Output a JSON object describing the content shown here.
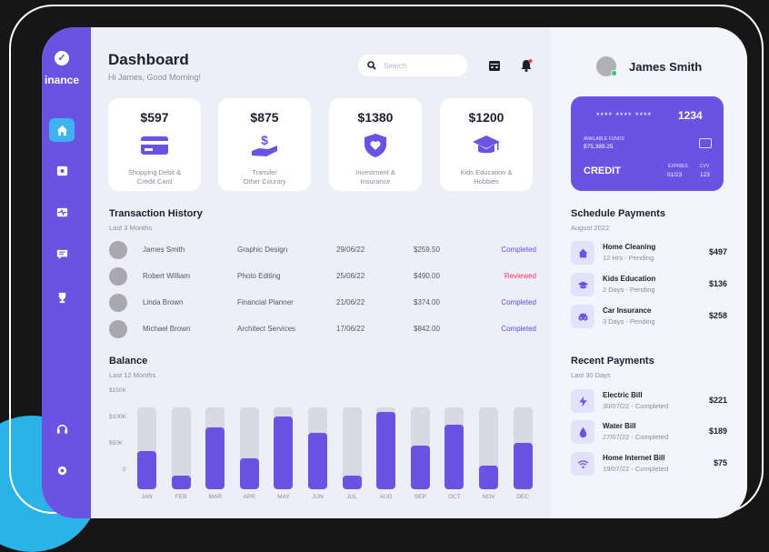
{
  "brand": {
    "logo_text": "inance"
  },
  "header": {
    "title": "Dashboard",
    "greeting": "Hi James, Good Morning!",
    "search_placeholder": "Search"
  },
  "user": {
    "name": "James Smith"
  },
  "stat_cards": [
    {
      "amount": "$597",
      "label_line1": "Shopping Debit &",
      "label_line2": "Credit Card",
      "icon": "credit-card-icon"
    },
    {
      "amount": "$875",
      "label_line1": "Transfer",
      "label_line2": "Other Country",
      "icon": "money-hand-icon"
    },
    {
      "amount": "$1380",
      "label_line1": "Investment &",
      "label_line2": "Insurance",
      "icon": "shield-heart-icon"
    },
    {
      "amount": "$1200",
      "label_line1": "Kids Education &",
      "label_line2": "Hobbies",
      "icon": "graduation-cap-icon"
    }
  ],
  "transactions": {
    "title": "Transaction History",
    "subtitle": "Last 3 Months",
    "rows": [
      {
        "name": "James Smith",
        "category": "Graphic Design",
        "date": "29/06/22",
        "amount": "$259.50",
        "status": "Completed"
      },
      {
        "name": "Robert William",
        "category": "Photo Editing",
        "date": "25/06/22",
        "amount": "$490.00",
        "status": "Reviewed"
      },
      {
        "name": "Linda Brown",
        "category": "Financial Planner",
        "date": "21/06/22",
        "amount": "$374.00",
        "status": "Completed"
      },
      {
        "name": "Michael Brown",
        "category": "Architect Services",
        "date": "17/06/22",
        "amount": "$842.00",
        "status": "Completed"
      }
    ]
  },
  "balance": {
    "title": "Balance",
    "subtitle": "Last 12 Months",
    "y_labels": [
      "$150K",
      "$100K",
      "$50K",
      "0"
    ]
  },
  "chart_data": {
    "type": "bar",
    "categories": [
      "JAN",
      "FEB",
      "MAR",
      "APR",
      "MAY",
      "JUN",
      "JUL",
      "AUG",
      "SEP",
      "OCT",
      "NOV",
      "DEC"
    ],
    "values": [
      72,
      25,
      117,
      58,
      137,
      107,
      25,
      147,
      82,
      122,
      45,
      88
    ],
    "ylim": [
      0,
      155
    ],
    "yticks": [
      "$150K",
      "$100K",
      "$50K",
      "0"
    ],
    "grid": false,
    "colors": {
      "fill": "#6a52e2",
      "track": "#d9d9e4"
    }
  },
  "card": {
    "masked": "**** **** ****",
    "last4": "1234",
    "funds_label": "AVAILABLE FUNDS",
    "funds_value": "$75,389.25",
    "type": "CREDIT",
    "expires_label": "EXPIRES",
    "expires_value": "01/23",
    "cvv_label": "CVV",
    "cvv_value": "123"
  },
  "schedule": {
    "title": "Schedule Payments",
    "subtitle": "August 2022",
    "items": [
      {
        "name": "Home Cleaning",
        "sub": "12 Hrs - Pending",
        "amount": "$497",
        "icon": "home-icon"
      },
      {
        "name": "Kids Education",
        "sub": "2 Days - Pending",
        "amount": "$136",
        "icon": "graduation-cap-icon"
      },
      {
        "name": "Car Insurance",
        "sub": "3 Days - Pending",
        "amount": "$258",
        "icon": "car-icon"
      }
    ]
  },
  "recent": {
    "title": "Recent Payments",
    "subtitle": "Last 30 Days",
    "items": [
      {
        "name": "Electric Bill",
        "sub": "30/07/22 - Completed",
        "amount": "$221",
        "icon": "lightning-icon"
      },
      {
        "name": "Water Bill",
        "sub": "27/07/22 - Completed",
        "amount": "$189",
        "icon": "water-drop-icon"
      },
      {
        "name": "Home Internet Bill",
        "sub": "19/07/22 - Completed",
        "amount": "$75",
        "icon": "wifi-icon"
      }
    ]
  },
  "colors": {
    "accent": "#6a52e2",
    "nav_active": "#3fb2f0",
    "completed": "#5a4fe0",
    "reviewed": "#ff2e63",
    "background": "#161616"
  }
}
